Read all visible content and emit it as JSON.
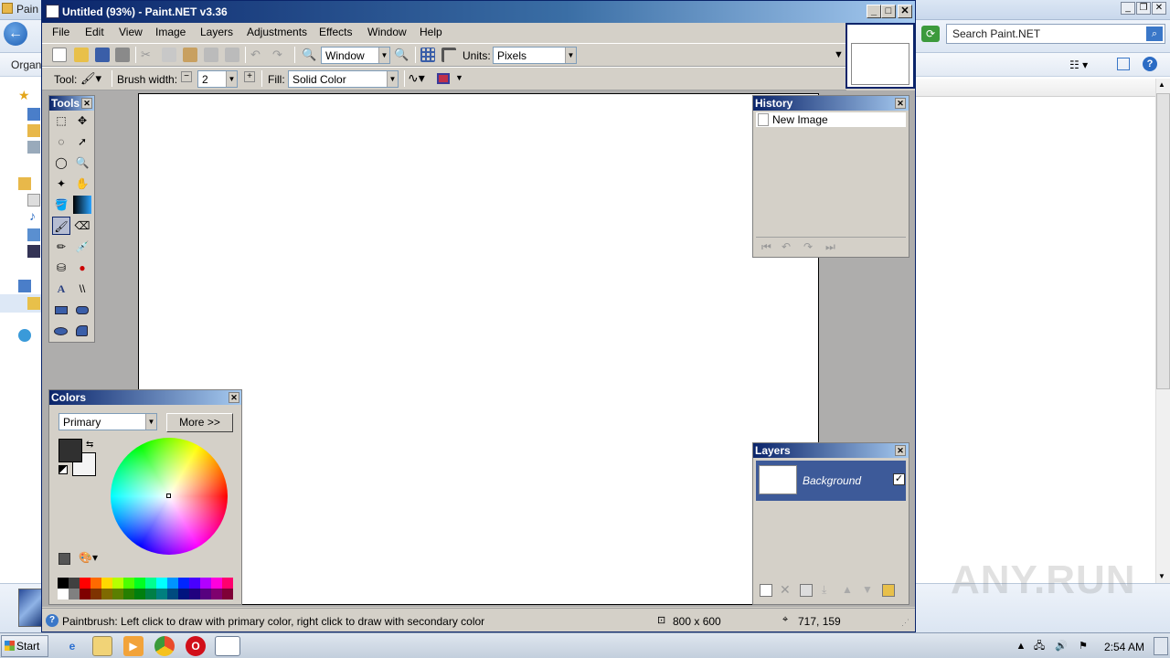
{
  "background_window": {
    "title": "Pain",
    "search_placeholder": "Search Paint.NET",
    "organize_label": "Organi"
  },
  "window": {
    "title": "Untitled (93%) - Paint.NET v3.36"
  },
  "menu": [
    "File",
    "Edit",
    "View",
    "Image",
    "Layers",
    "Adjustments",
    "Effects",
    "Window",
    "Help"
  ],
  "toolbar": {
    "zoom_value": "Window",
    "units_label": "Units:",
    "units_value": "Pixels",
    "tool_label": "Tool:",
    "brush_width_label": "Brush width:",
    "brush_width_value": "2",
    "fill_label": "Fill:",
    "fill_value": "Solid Color"
  },
  "tools_panel": {
    "title": "Tools"
  },
  "history_panel": {
    "title": "History",
    "items": [
      "New Image"
    ]
  },
  "colors_panel": {
    "title": "Colors",
    "mode": "Primary",
    "more_label": "More >>",
    "primary_color": "#303030",
    "secondary_color": "#f4f4f4",
    "palette": [
      "#000000",
      "#404040",
      "#ff0000",
      "#ff6a00",
      "#ffd800",
      "#b6ff00",
      "#4cff00",
      "#00ff21",
      "#00ff90",
      "#00ffff",
      "#0094ff",
      "#0026ff",
      "#4800ff",
      "#b200ff",
      "#ff00dc",
      "#ff006e"
    ],
    "palette_dark": [
      "#ffffff",
      "#808080",
      "#7f0000",
      "#7f3300",
      "#7f6a00",
      "#5b7f00",
      "#267f00",
      "#007f0e",
      "#007f46",
      "#007f7f",
      "#004a7f",
      "#00137f",
      "#21007f",
      "#57007f",
      "#7f006e",
      "#7f0037"
    ]
  },
  "layers_panel": {
    "title": "Layers",
    "layers": [
      {
        "name": "Background",
        "visible": true
      }
    ]
  },
  "status": {
    "text": "Paintbrush: Left click to draw with primary color, right click to draw with secondary color",
    "image_size": "800 x 600",
    "cursor_pos": "717, 159"
  },
  "taskbar": {
    "start_label": "Start",
    "clock": "2:54 AM"
  },
  "watermark": "ANY.RUN"
}
